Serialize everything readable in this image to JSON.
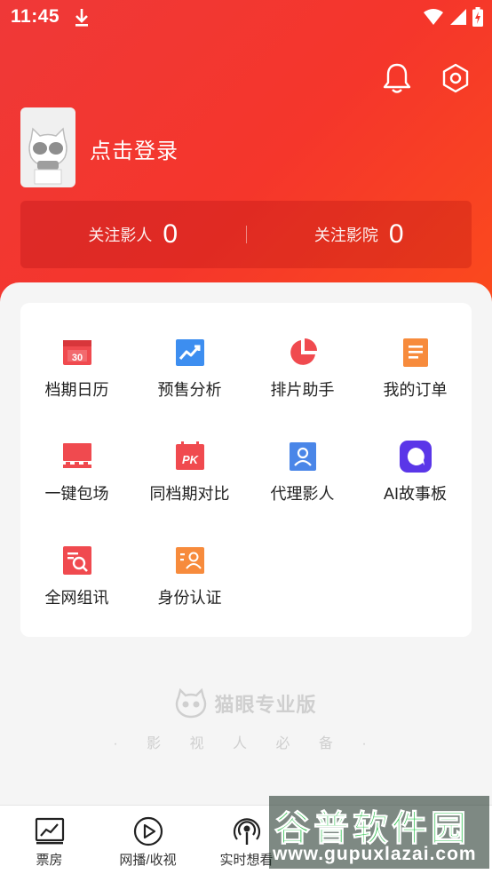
{
  "status_bar": {
    "time": "11:45"
  },
  "profile": {
    "login_label": "点击登录"
  },
  "follow": [
    {
      "label": "关注影人",
      "value": "0"
    },
    {
      "label": "关注影院",
      "value": "0"
    }
  ],
  "features": [
    {
      "label": "档期日历",
      "icon": "calendar-icon"
    },
    {
      "label": "预售分析",
      "icon": "trend-chart-icon"
    },
    {
      "label": "排片助手",
      "icon": "pie-chart-icon"
    },
    {
      "label": "我的订单",
      "icon": "order-document-icon"
    },
    {
      "label": "一键包场",
      "icon": "cinema-screen-icon"
    },
    {
      "label": "同档期对比",
      "icon": "pk-calendar-icon"
    },
    {
      "label": "代理影人",
      "icon": "agent-person-icon"
    },
    {
      "label": "AI故事板",
      "icon": "ai-chat-icon"
    },
    {
      "label": "全网组讯",
      "icon": "search-document-icon"
    },
    {
      "label": "身份认证",
      "icon": "identity-card-icon"
    }
  ],
  "brand": {
    "name": "猫眼专业版",
    "tagline": "· 影 视 人 必 备 ·"
  },
  "tabs": [
    {
      "label": "票房",
      "icon": "box-office-icon"
    },
    {
      "label": "网播/收视",
      "icon": "play-icon"
    },
    {
      "label": "实时想看",
      "icon": "broadcast-icon"
    }
  ],
  "watermark": {
    "title": "谷普软件园",
    "url": "www.gupuxlazai.com"
  },
  "colors": {
    "accent": "#f5362b",
    "brand_gray": "#cfcfcf"
  }
}
